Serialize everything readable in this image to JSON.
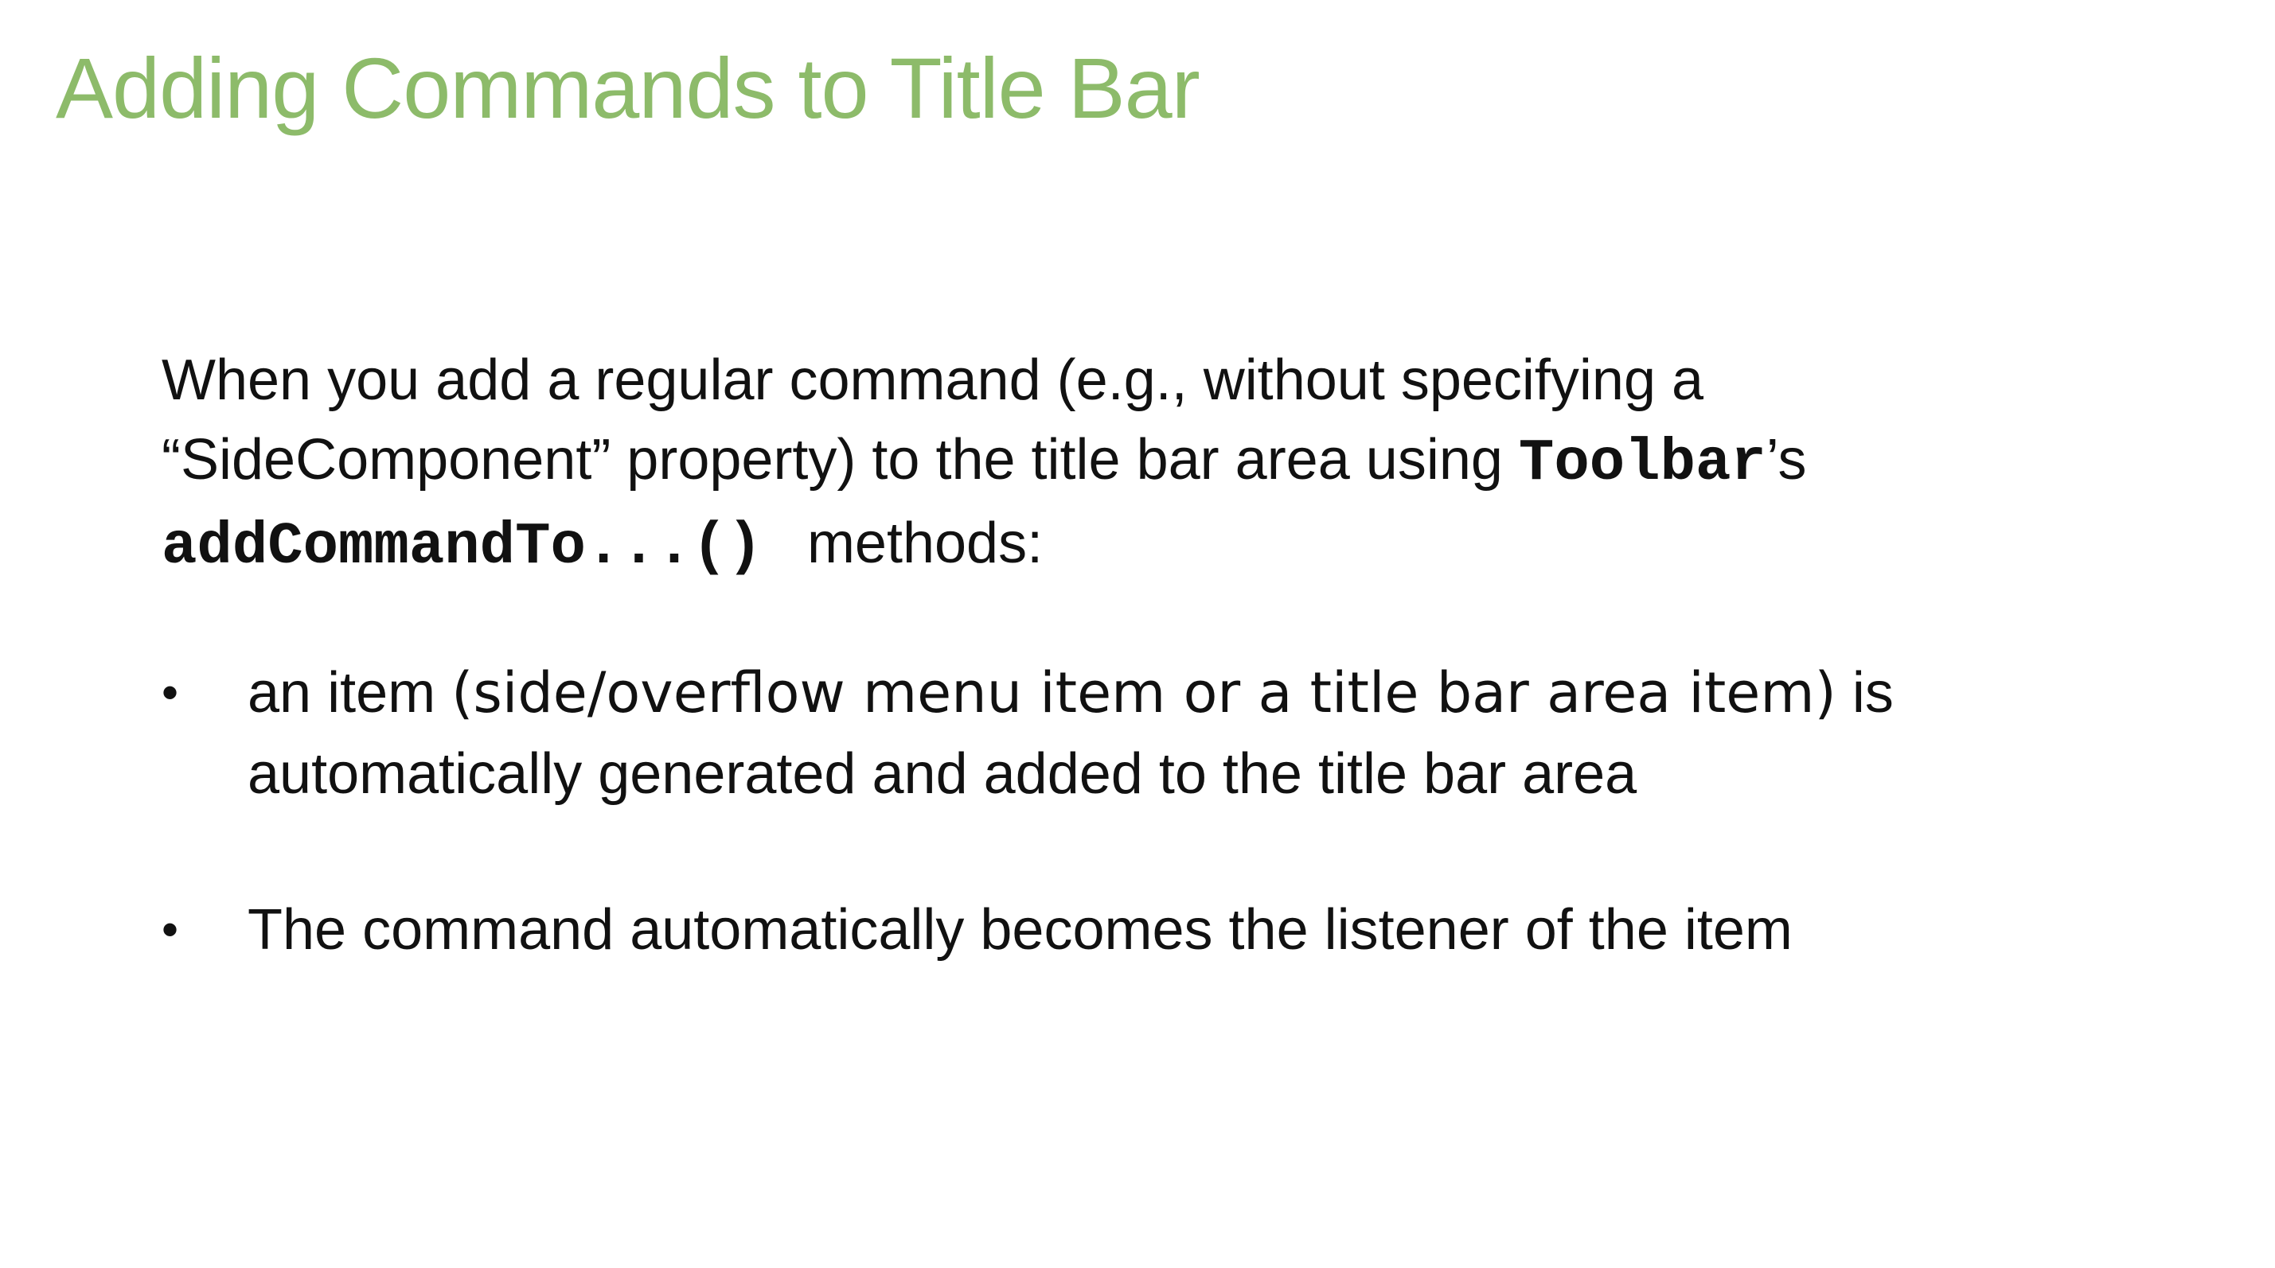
{
  "slide": {
    "title": "Adding Commands to Title Bar",
    "accent_color": "#8dbb6a",
    "intro": {
      "line1": "When you add a regular command (e.g., without specifying a",
      "line2_text": "“SideComponent” property) to the title bar area using ",
      "line2_code": "Toolbar",
      "line2_suffix": "’s",
      "line3_code": "addCommandTo...()",
      "line3_text": "methods:"
    },
    "bullets": [
      {
        "marker": "•",
        "line1_prefix": "an item ",
        "line1_highlight": "(side/overflow menu item or a title bar area item)",
        "line1_suffix": " is",
        "line2": "automatically generated and added to the title bar area"
      },
      {
        "marker": "•",
        "line1": "The command automatically becomes the listener of the item"
      }
    ]
  }
}
